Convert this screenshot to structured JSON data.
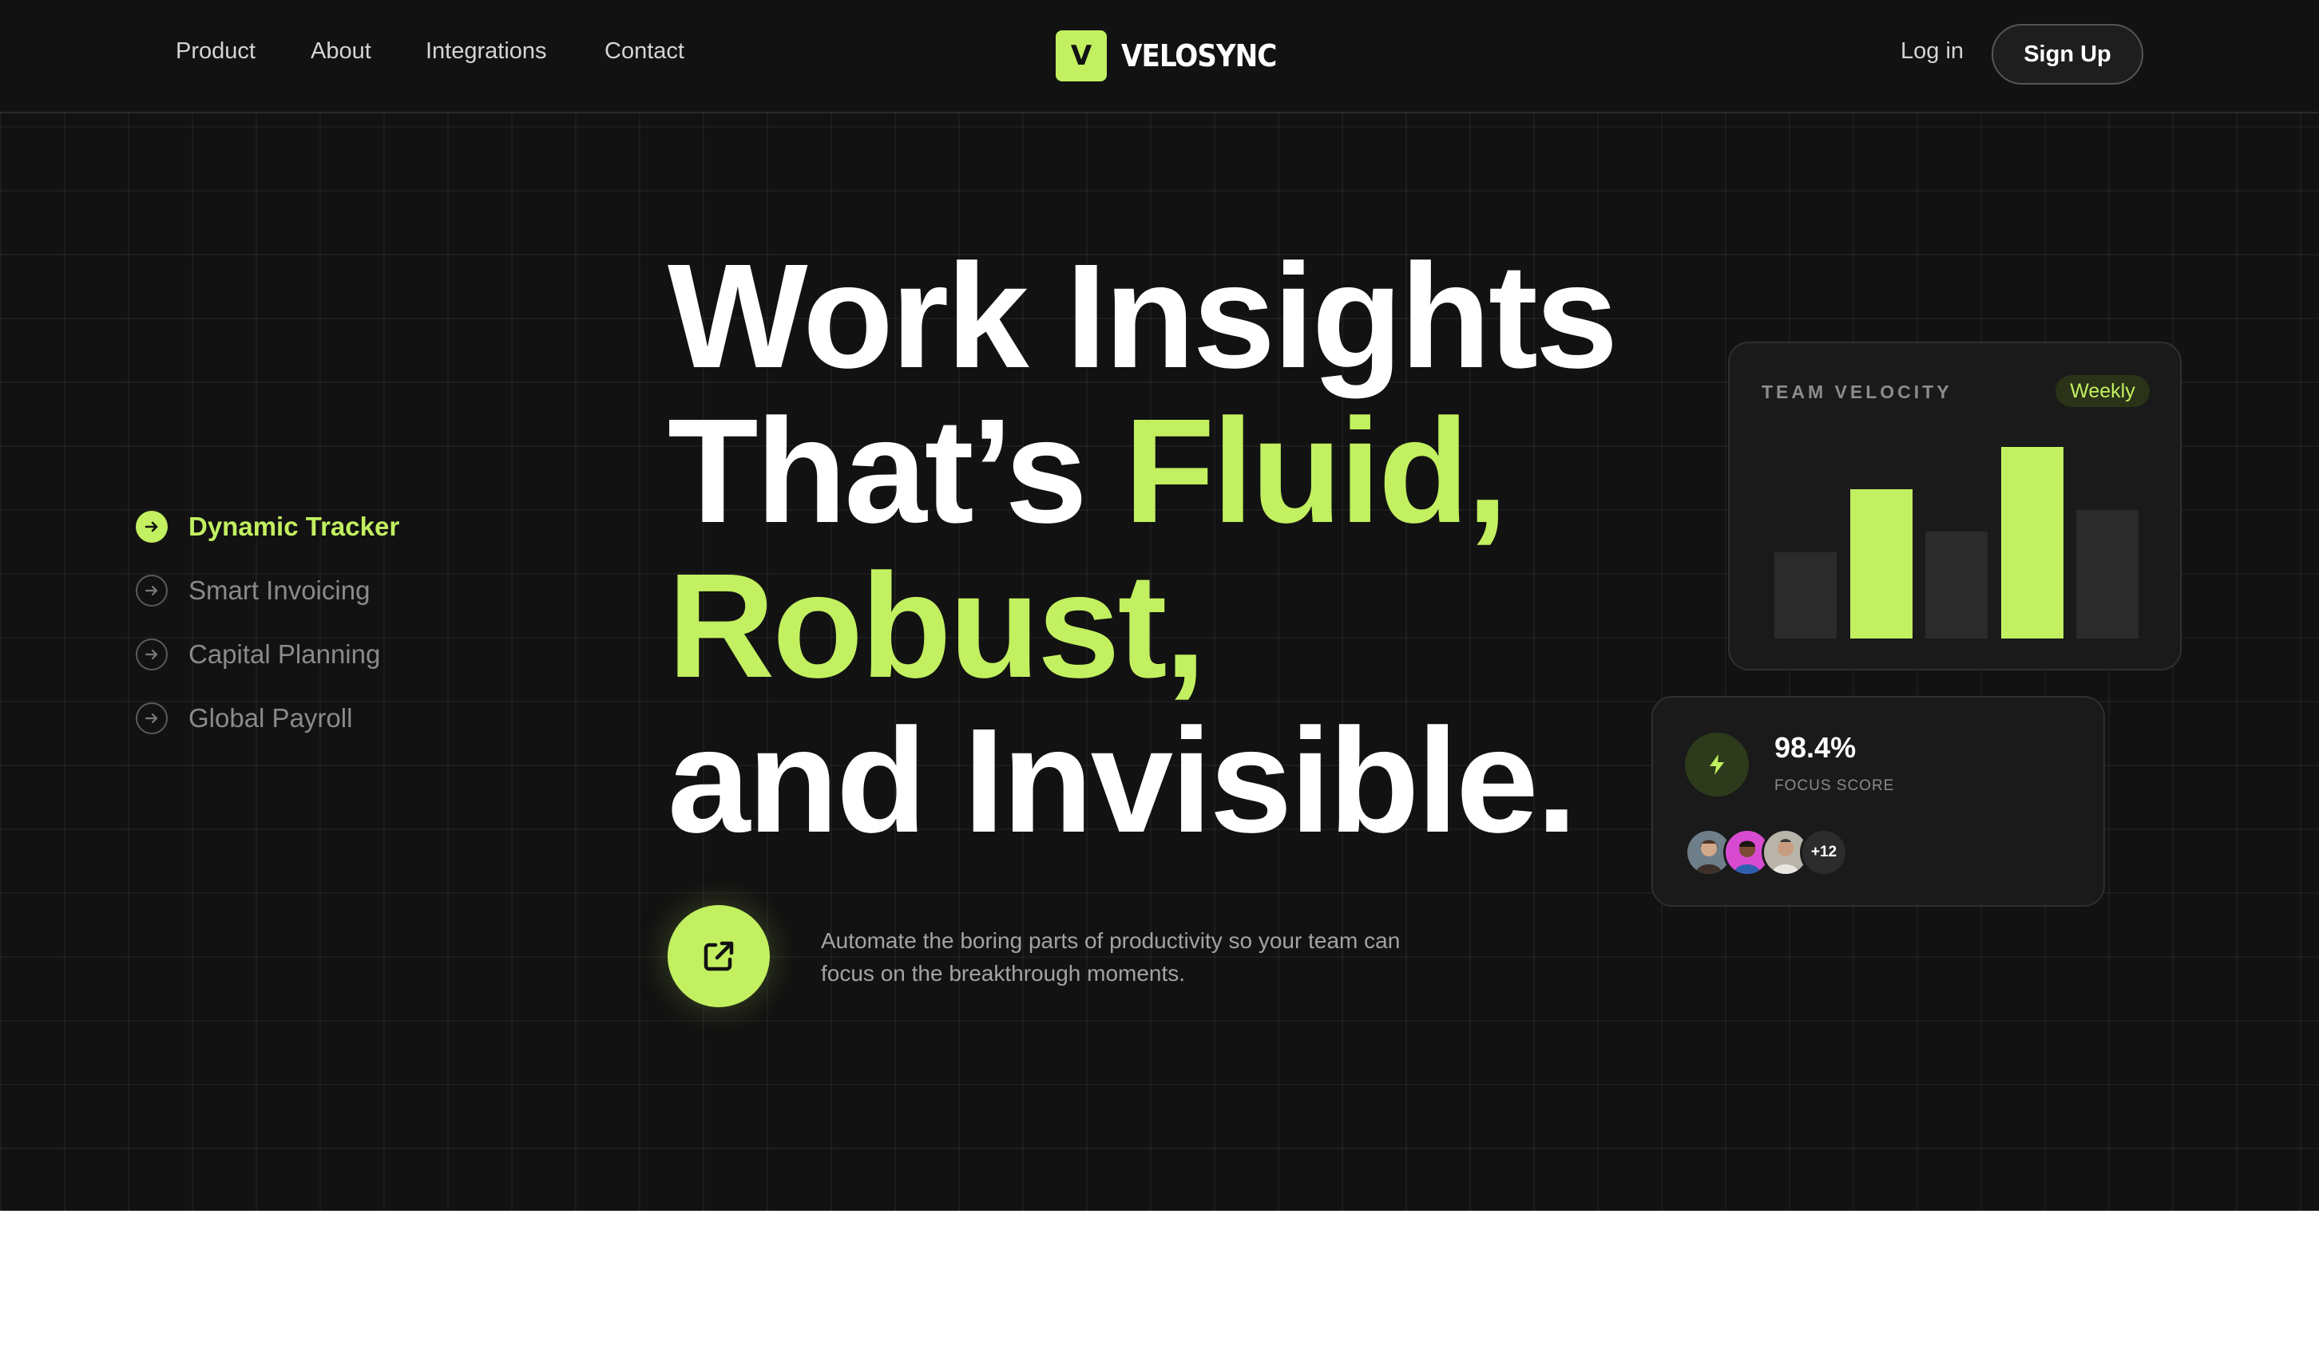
{
  "nav": {
    "links": [
      "Product",
      "About",
      "Integrations",
      "Contact"
    ],
    "brand_initial": "V",
    "brand_name": "VELOSYNC",
    "login": "Log in",
    "signup": "Sign Up"
  },
  "features": [
    {
      "label": "Dynamic Tracker",
      "active": true,
      "icon": "arrow-right-icon"
    },
    {
      "label": "Smart Invoicing",
      "active": false,
      "icon": "arrow-right-icon"
    },
    {
      "label": "Capital Planning",
      "active": false,
      "icon": "arrow-right-icon"
    },
    {
      "label": "Global Payroll",
      "active": false,
      "icon": "arrow-right-icon"
    }
  ],
  "headline": {
    "line1": "Work Insights",
    "line2_prefix": "That’s ",
    "line2_accent": "Fluid,",
    "line3_accent": "Robust,",
    "line4": "and Invisible."
  },
  "cta": {
    "icon": "external-link-icon"
  },
  "tagline": "Automate the boring parts of productivity so your team can focus on the breakthrough moments.",
  "velocity_card": {
    "title": "TEAM VELOCITY",
    "badge": "Weekly"
  },
  "chart_data": {
    "type": "bar",
    "title": "TEAM VELOCITY",
    "categories": [
      "",
      "",
      "",
      "",
      ""
    ],
    "values": [
      45,
      78,
      56,
      100,
      67
    ],
    "highlighted": [
      false,
      true,
      false,
      true,
      false
    ],
    "ylim": [
      0,
      100
    ],
    "grid": false,
    "colors": {
      "highlight": "#c2f060",
      "muted": "#2b2b2b"
    }
  },
  "focus_card": {
    "value": "98.4%",
    "label": "FOCUS SCORE",
    "icon": "lightning-icon",
    "more_count": "+12"
  },
  "colors": {
    "accent": "#c2f060",
    "background": "#121212",
    "card": "#1a1a1a"
  }
}
